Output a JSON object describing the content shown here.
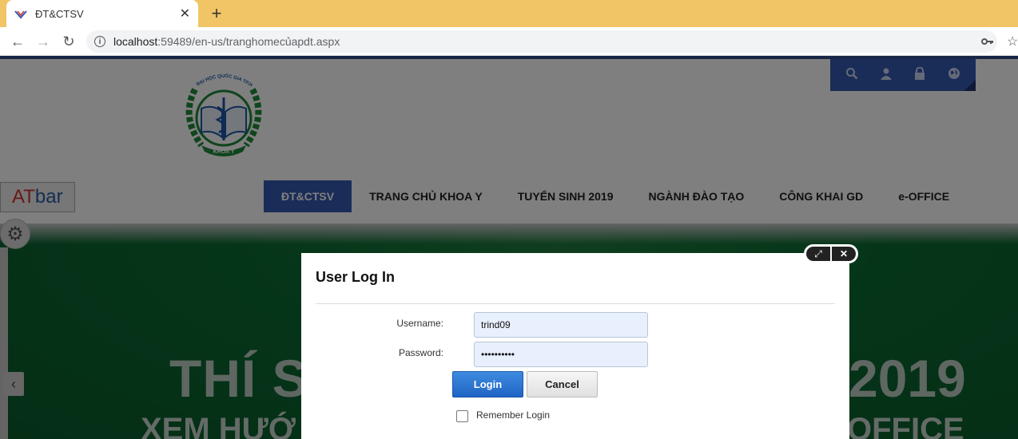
{
  "browser": {
    "tab_title": "ĐT&CTSV",
    "url_host": "localhost",
    "url_path": ":59489/en-us/tranghomecủapdt.aspx"
  },
  "header": {
    "atbar_at": "AT",
    "atbar_bar": "bar",
    "menu": [
      {
        "label": "ĐT&CTSV",
        "active": true
      },
      {
        "label": "TRANG CHỦ KHOA Y"
      },
      {
        "label": "TUYỂN SINH 2019"
      },
      {
        "label": "NGÀNH ĐÀO TẠO"
      },
      {
        "label": "CÔNG KHAI GD"
      },
      {
        "label": "e-OFFICE"
      }
    ]
  },
  "banner": {
    "line1_left": "THÍ S",
    "line1_right": "2019",
    "line2_left": "XEM HƯỚ",
    "line2_right": "OFFICE"
  },
  "logo": {
    "arc_text": "ĐẠI HỌC QUỐC GIA TP.HỒ CHÍ MINH",
    "ribbon_text": "KHOA Y"
  },
  "login_dialog": {
    "title": "User Log In",
    "username_label": "Username:",
    "username_value": "trind09",
    "password_label": "Password:",
    "password_value": "••••••••••",
    "login_button": "Login",
    "cancel_button": "Cancel",
    "remember_label": "Remember Login"
  },
  "colors": {
    "accent": "#3559b0",
    "tabbar": "#f1c566",
    "login_button": "#1f64c4",
    "banner_green": "#0b6b33"
  }
}
